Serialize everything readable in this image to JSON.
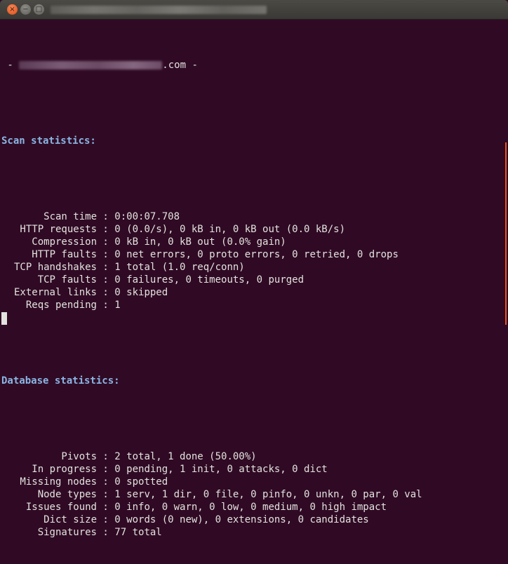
{
  "window": {
    "title_redacted": true,
    "controls": {
      "close": "×",
      "minimize": "−",
      "maximize": "□"
    }
  },
  "terminal": {
    "header_prefix": " - ",
    "header_domain_suffix": ".com",
    "header_end": " -",
    "scan_title": "Scan statistics:",
    "scan": [
      {
        "label": "Scan time",
        "value": "0:00:07.708"
      },
      {
        "label": "HTTP requests",
        "value": "0 (0.0/s), 0 kB in, 0 kB out (0.0 kB/s)"
      },
      {
        "label": "Compression",
        "value": "0 kB in, 0 kB out (0.0% gain)"
      },
      {
        "label": "HTTP faults",
        "value": "0 net errors, 0 proto errors, 0 retried, 0 drops"
      },
      {
        "label": "TCP handshakes",
        "value": "1 total (1.0 req/conn)"
      },
      {
        "label": "TCP faults",
        "value": "0 failures, 0 timeouts, 0 purged"
      },
      {
        "label": "External links",
        "value": "0 skipped"
      },
      {
        "label": "Reqs pending",
        "value": "1"
      }
    ],
    "db_title": "Database statistics:",
    "db": [
      {
        "label": "Pivots",
        "value": "2 total, 1 done (50.00%)"
      },
      {
        "label": "In progress",
        "value": "0 pending, 1 init, 0 attacks, 0 dict"
      },
      {
        "label": "Missing nodes",
        "value": "0 spotted"
      },
      {
        "label": "Node types",
        "value": "1 serv, 1 dir, 0 file, 0 pinfo, 0 unkn, 0 par, 0 val"
      },
      {
        "label": "Issues found",
        "value": "0 info, 0 warn, 0 low, 0 medium, 0 high impact"
      },
      {
        "label": "Dict size",
        "value": "0 words (0 new), 0 extensions, 0 candidates"
      },
      {
        "label": "Signatures",
        "value": "77 total"
      }
    ],
    "separator": " : "
  },
  "colors": {
    "background": "#300a24",
    "text": "#e3e3df",
    "header": "#8bb5e4",
    "scrollbar": "#e9541f"
  }
}
